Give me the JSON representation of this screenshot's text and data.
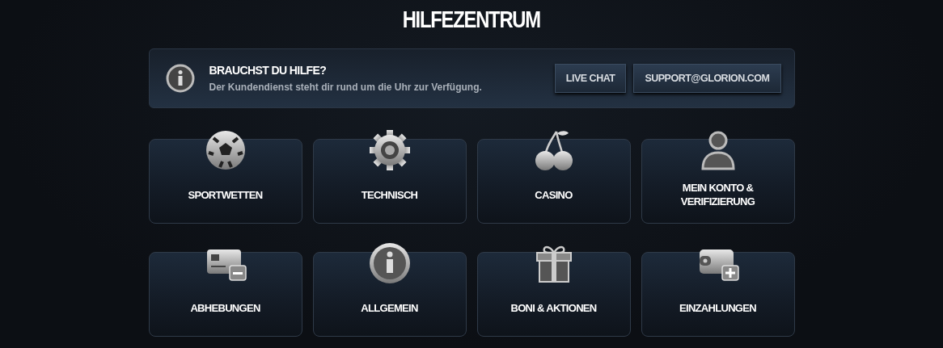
{
  "title": "HILFEZENTRUM",
  "banner": {
    "heading": "BRAUCHST DU HILFE?",
    "text": "Der Kundendienst steht dir rund um die Uhr zur Verfügung.",
    "buttons": [
      "LIVE CHAT",
      "SUPPORT@GLORION.COM"
    ]
  },
  "categories": [
    {
      "kind": "football",
      "label": "SPORTWETTEN"
    },
    {
      "kind": "gear",
      "label": "TECHNISCH"
    },
    {
      "kind": "cherries",
      "label": "CASINO"
    },
    {
      "kind": "user",
      "label": "MEIN KONTO & VERIFIZIERUNG"
    },
    {
      "kind": "card-minus",
      "label": "ABHEBUNGEN"
    },
    {
      "kind": "info",
      "label": "ALLGEMEIN"
    },
    {
      "kind": "gift",
      "label": "BONI & AKTIONEN"
    },
    {
      "kind": "wallet-plus",
      "label": "EINZAHLUNGEN"
    }
  ]
}
